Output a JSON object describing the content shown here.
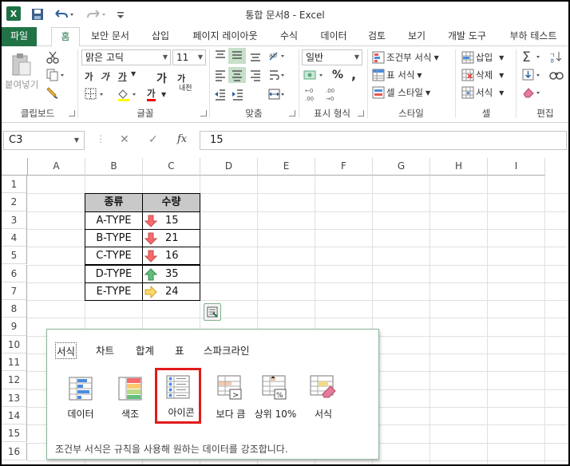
{
  "window": {
    "title": "통합 문서8 - Excel",
    "app_icon": "X"
  },
  "quick_access": [
    "save-icon",
    "undo-icon",
    "redo-icon",
    "customize-icon"
  ],
  "tabs": [
    "파일",
    "홈",
    "보안 문서",
    "삽입",
    "페이지 레이아웃",
    "수식",
    "데이터",
    "검토",
    "보기",
    "개발 도구",
    "부하 테스트"
  ],
  "ribbon": {
    "clipboard": {
      "paste": "붙여넣기",
      "label": "클립보드"
    },
    "font": {
      "name": "맑은 고딕",
      "size": "11",
      "bold": "가",
      "italic": "가",
      "underline": "가",
      "grow": "가",
      "shrink": "가",
      "font_color": "가",
      "phonetic": "내천",
      "label": "글꼴"
    },
    "alignment": {
      "label": "맞춤"
    },
    "number": {
      "format": "일반",
      "percent": "%",
      "comma": ",",
      "label": "표시 형식"
    },
    "styles": {
      "conditional": "조건부 서식",
      "table": "표 서식",
      "cell": "셀 스타일",
      "label": "스타일"
    },
    "cells": {
      "insert": "삽입",
      "delete": "삭제",
      "format": "서식",
      "label": "셀"
    },
    "editing": {
      "label": "편집"
    }
  },
  "formula": {
    "namebox": "C3",
    "fx": "fx",
    "value": "15"
  },
  "columns": [
    "A",
    "B",
    "C",
    "D",
    "E",
    "F",
    "G",
    "H",
    "I"
  ],
  "rows": [
    "1",
    "2",
    "3",
    "4",
    "5",
    "6",
    "7",
    "8",
    "9",
    "10",
    "11",
    "12",
    "13",
    "14",
    "15",
    "16"
  ],
  "table": {
    "headers": [
      "종류",
      "수량"
    ],
    "rows": [
      {
        "type": "A-TYPE",
        "qty": "15",
        "arrow": "down"
      },
      {
        "type": "B-TYPE",
        "qty": "21",
        "arrow": "down"
      },
      {
        "type": "C-TYPE",
        "qty": "16",
        "arrow": "down"
      },
      {
        "type": "D-TYPE",
        "qty": "35",
        "arrow": "up"
      },
      {
        "type": "E-TYPE",
        "qty": "24",
        "arrow": "right"
      }
    ]
  },
  "quick_analysis": {
    "tabs": [
      "서식",
      "차트",
      "합계",
      "표",
      "스파크라인"
    ],
    "options": [
      "데이터",
      "색조",
      "아이콘",
      "보다 큼",
      "상위 10%",
      "서식"
    ],
    "description": "조건부 서식은 규칙을 사용해 원하는 데이터를 강조합니다."
  },
  "colors": {
    "excel_green": "#217346",
    "header_fill": "#c9c9c9",
    "highlight": "#e21b1b"
  }
}
